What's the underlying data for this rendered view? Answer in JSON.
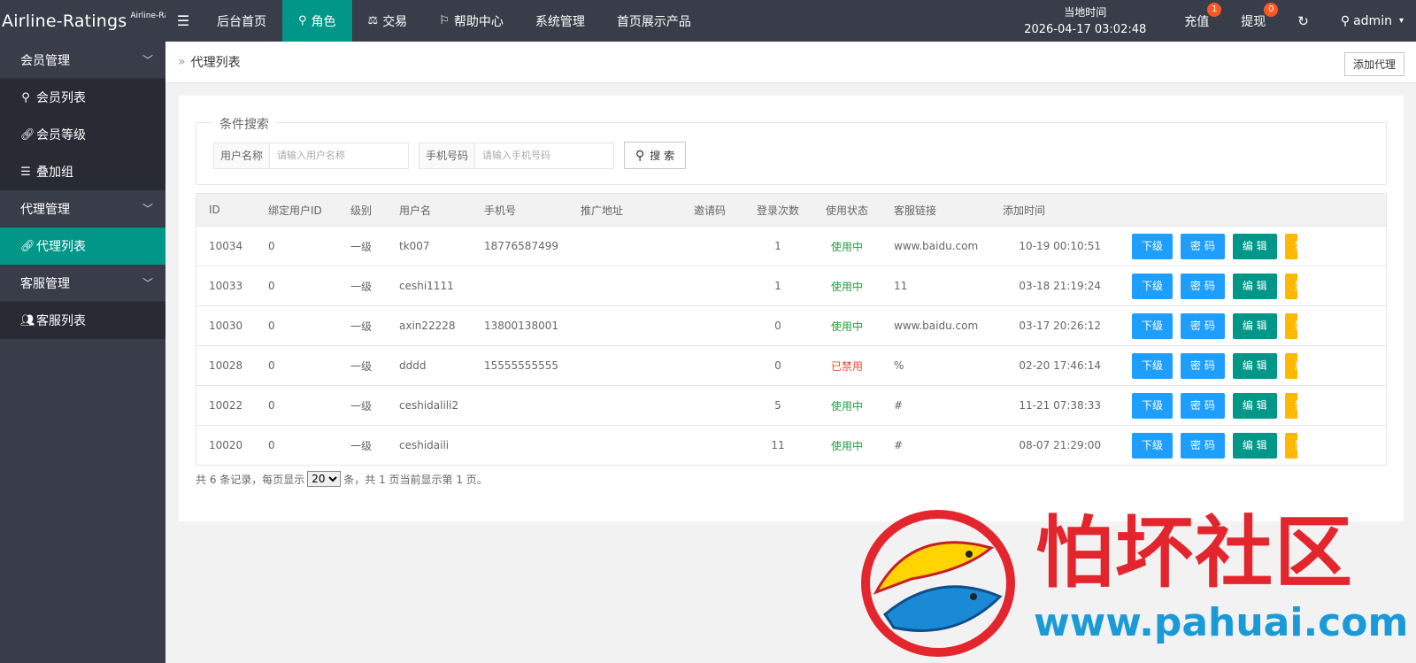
{
  "header": {
    "logo_main": "Airline-Ratings",
    "logo_sub": "Airline-Ratings",
    "nav": [
      {
        "label": "后台首页",
        "icon": ""
      },
      {
        "label": "角色",
        "icon": "user-icon"
      },
      {
        "label": "交易",
        "icon": "scale-icon"
      },
      {
        "label": "帮助中心",
        "icon": "flag-icon"
      },
      {
        "label": "系统管理",
        "icon": ""
      },
      {
        "label": "首页展示产品",
        "icon": ""
      }
    ],
    "time_label": "当地时间",
    "time_value": "2026-04-17 03:02:48",
    "recharge": "充值",
    "recharge_count": "1",
    "withdraw": "提现",
    "withdraw_count": "0",
    "user": "admin"
  },
  "sidebar": {
    "groups": [
      {
        "label": "会员管理",
        "items": [
          {
            "label": "会员列表",
            "icon": "user-icon"
          },
          {
            "label": "会员等级",
            "icon": "link-icon"
          },
          {
            "label": "叠加组",
            "icon": "list-icon"
          }
        ]
      },
      {
        "label": "代理管理",
        "items": [
          {
            "label": "代理列表",
            "icon": "link-icon"
          }
        ]
      },
      {
        "label": "客服管理",
        "items": [
          {
            "label": "客服列表",
            "icon": "users-icon"
          }
        ]
      }
    ]
  },
  "breadcrumb": {
    "title": "代理列表",
    "add_button": "添加代理"
  },
  "search": {
    "legend": "条件搜索",
    "username_label": "用户名称",
    "username_placeholder": "请输入用户名称",
    "phone_label": "手机号码",
    "phone_placeholder": "请输入手机号码",
    "button": "搜 索"
  },
  "table": {
    "headers": [
      "ID",
      "绑定用户ID",
      "级别",
      "用户名",
      "手机号",
      "推广地址",
      "邀请码",
      "登录次数",
      "使用状态",
      "客服链接",
      "添加时间"
    ],
    "rows": [
      {
        "id": "10034",
        "bind": "0",
        "level": "一级",
        "user": "tk007",
        "phone": "18776587499",
        "promo": "",
        "invite": "",
        "logins": "1",
        "status": "使用中",
        "status_on": true,
        "link": "www.baidu.com",
        "time": "10-19 00:10:51",
        "toggle": "禁用"
      },
      {
        "id": "10033",
        "bind": "0",
        "level": "一级",
        "user": "ceshi1111",
        "phone": "",
        "promo": "",
        "invite": "",
        "logins": "1",
        "status": "使用中",
        "status_on": true,
        "link": "11",
        "time": "03-18 21:19:24",
        "toggle": "禁用"
      },
      {
        "id": "10030",
        "bind": "0",
        "level": "一级",
        "user": "axin22228",
        "phone": "13800138001",
        "promo": "",
        "invite": "",
        "logins": "0",
        "status": "使用中",
        "status_on": true,
        "link": "www.baidu.com",
        "time": "03-17 20:26:12",
        "toggle": "禁用"
      },
      {
        "id": "10028",
        "bind": "0",
        "level": "一级",
        "user": "dddd",
        "phone": "15555555555",
        "promo": "",
        "invite": "",
        "logins": "0",
        "status": "已禁用",
        "status_on": false,
        "link": "%",
        "time": "02-20 17:46:14",
        "toggle": "启用"
      },
      {
        "id": "10022",
        "bind": "0",
        "level": "一级",
        "user": "ceshidalili2",
        "phone": "",
        "promo": "",
        "invite": "",
        "logins": "5",
        "status": "使用中",
        "status_on": true,
        "link": "#",
        "time": "11-21 07:38:33",
        "toggle": "禁用"
      },
      {
        "id": "10020",
        "bind": "0",
        "level": "一级",
        "user": "ceshidaili",
        "phone": "",
        "promo": "",
        "invite": "",
        "logins": "11",
        "status": "使用中",
        "status_on": true,
        "link": "#",
        "time": "08-07 21:29:00",
        "toggle": "禁用"
      }
    ],
    "op_sub": "下级",
    "op_pwd": "密 码",
    "op_edit": "编 辑"
  },
  "pager": {
    "prefix": "共 6 条记录，每页显示",
    "per_page": "20",
    "suffix": "条，共 1 页当前显示第 1 页。"
  },
  "watermark": {
    "text": "怕坏社区",
    "url": "www.pahuai.com"
  },
  "colors": {
    "header_bg": "#393d49",
    "accent": "#009688",
    "blue": "#1e9fff",
    "yellow": "#ffb800",
    "badge": "#ff5722"
  }
}
